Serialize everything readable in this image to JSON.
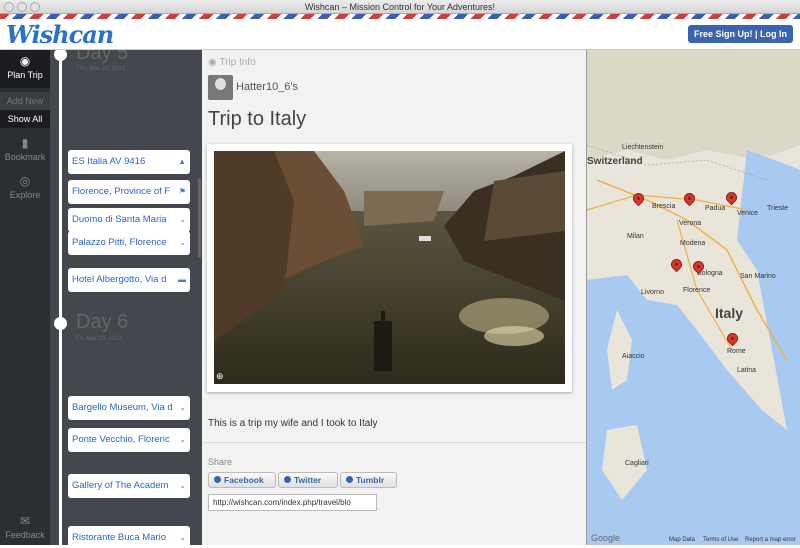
{
  "window": {
    "title": "Wishcan – Mission Control for Your Adventures!"
  },
  "header": {
    "logo": "Wishcan",
    "signup_label": "Free Sign Up! | Log In"
  },
  "left_nav": {
    "plan_trip": "Plan Trip",
    "add_new": "Add New",
    "show_all": "Show All",
    "bookmark": "Bookmark",
    "explore": "Explore",
    "feedback": "Feedback"
  },
  "timeline": {
    "day5": {
      "label": "Day 5",
      "date": "Thu, Mar 22, 2012"
    },
    "day6": {
      "label": "Day 6",
      "date": "Fri, Mar 23, 2012"
    },
    "cards": [
      "ES Italia AV 9416",
      "Florence, Province of F",
      "Duomo di Santa Maria",
      "Palazzo Pitti, Florence",
      "Hotel Albergotto, Via d",
      "Bargello Museum, Via d",
      "Ponte Vecchio, Florenc",
      "Gallery of The Academ",
      "Ristorante Buca Mario"
    ]
  },
  "trip": {
    "section_label": "Trip Info",
    "username": "Hatter10_6's",
    "title": "Trip to Italy",
    "description": "This is a trip my wife and I took to Italy",
    "share_label": "Share",
    "share_buttons": [
      "Facebook",
      "Twitter",
      "Tumblr"
    ],
    "url": "http://wishcan.com/index.php/travel/blo"
  },
  "map": {
    "labels": [
      "Switzerland",
      "Liechtenstein",
      "Milan",
      "Brescia",
      "Verona",
      "Padua",
      "Venice",
      "Trieste",
      "Modena",
      "Bologna",
      "Florence",
      "Livorno",
      "San Marino",
      "Italy",
      "Rome",
      "Latina",
      "Aiaccio",
      "Cagliari"
    ],
    "footer": [
      "Map Data",
      "Terms of Use",
      "Report a map error"
    ],
    "google": "Google"
  }
}
